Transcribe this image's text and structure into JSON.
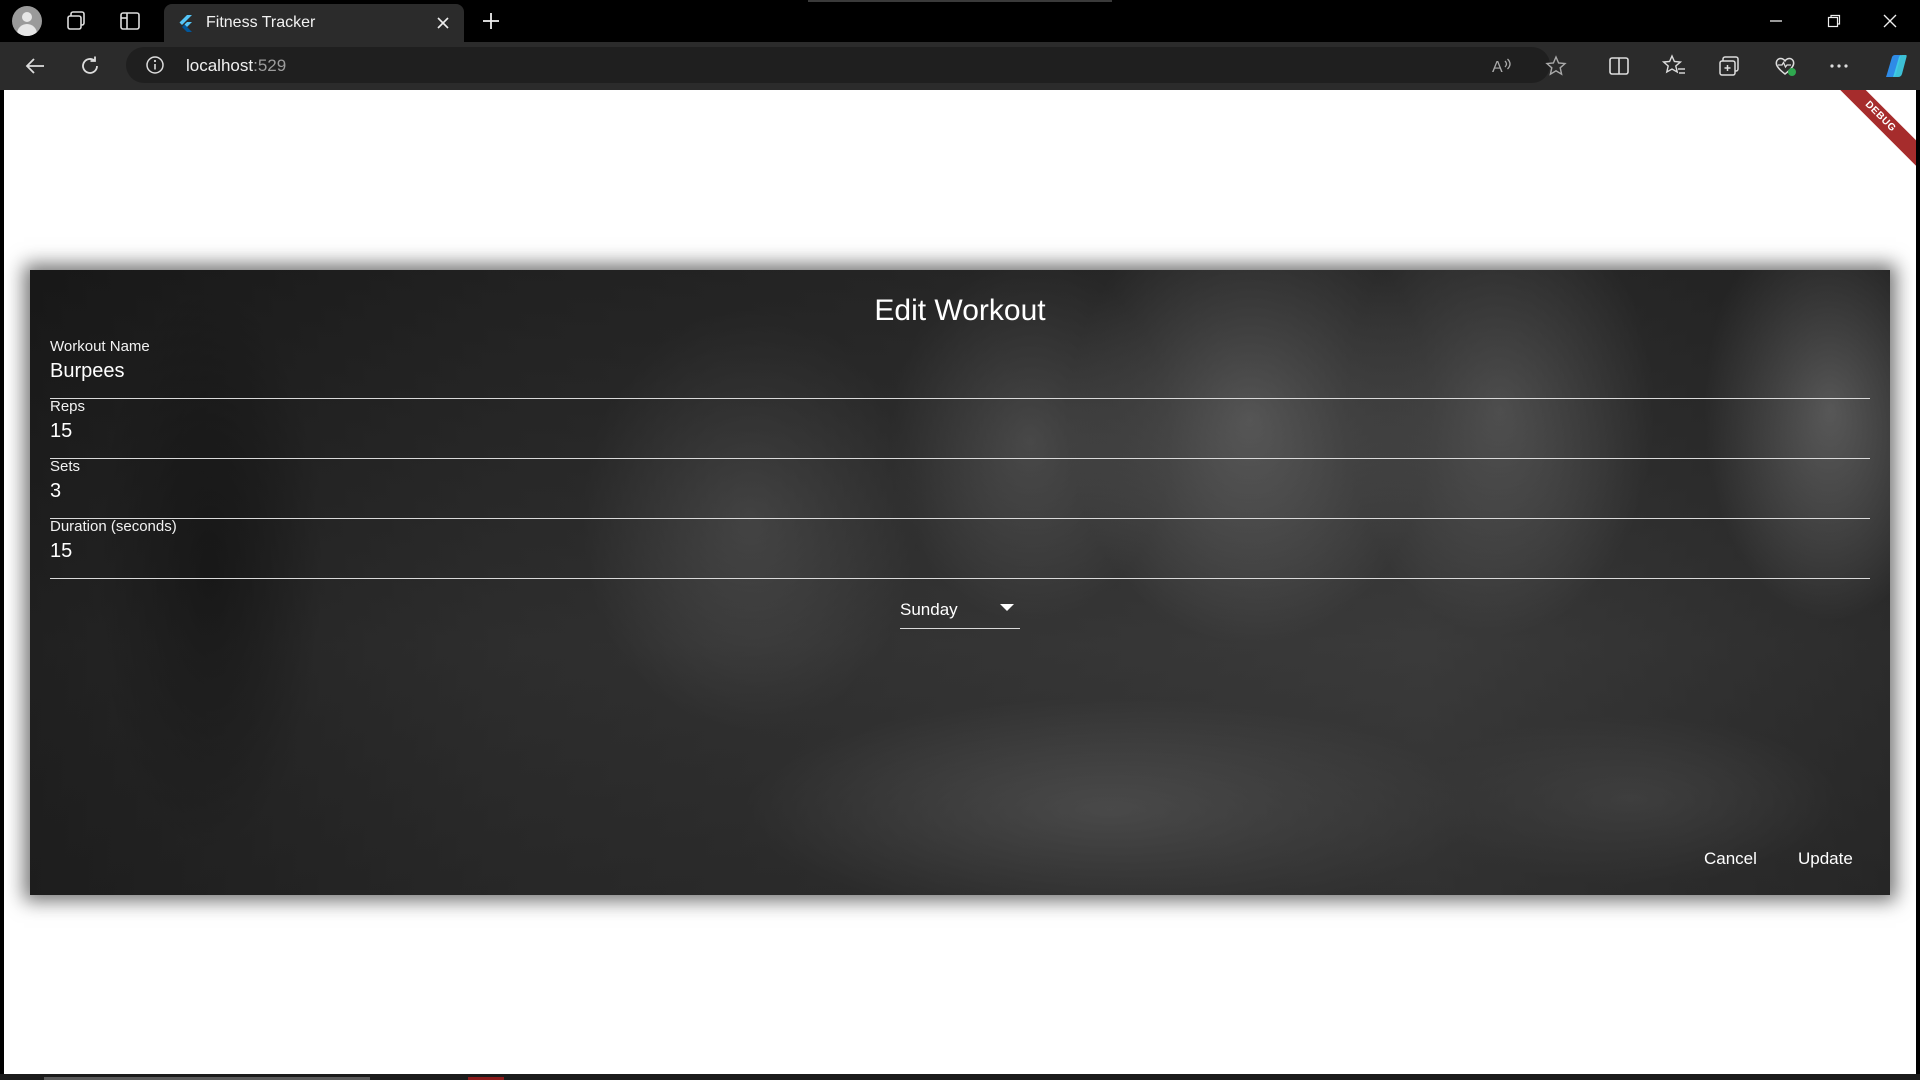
{
  "browser": {
    "tab": {
      "title": "Fitness Tracker"
    },
    "address": {
      "host": "localhost",
      "port": ":529"
    }
  },
  "app": {
    "debug_banner": "DEBUG"
  },
  "dialog": {
    "title": "Edit Workout",
    "fields": [
      {
        "label": "Workout Name",
        "value": "Burpees"
      },
      {
        "label": "Reps",
        "value": "15"
      },
      {
        "label": "Sets",
        "value": "3"
      },
      {
        "label": "Duration (seconds)",
        "value": "15"
      }
    ],
    "day": {
      "selected": "Sunday"
    },
    "buttons": {
      "cancel": "Cancel",
      "update": "Update"
    }
  },
  "colors": {
    "titlebar": "#000000",
    "toolbar": "#2b2b2b",
    "debug_banner": "#a62c2c",
    "text": "#ffffff"
  }
}
